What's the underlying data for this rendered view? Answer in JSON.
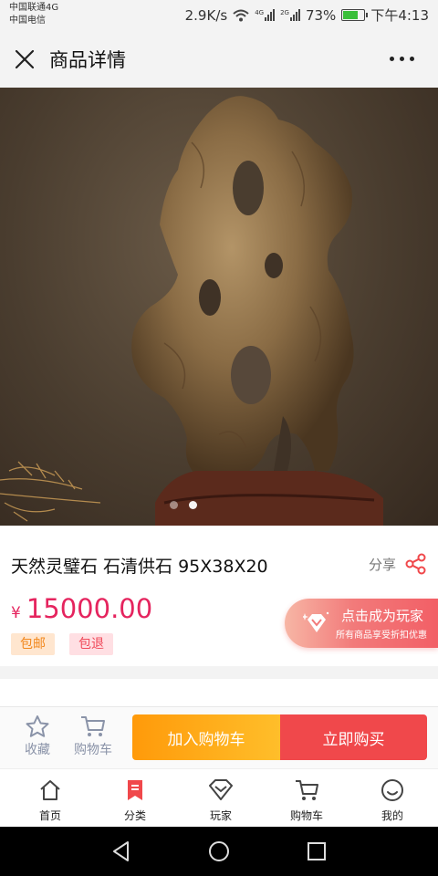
{
  "status": {
    "carrier1": "中国联通4G",
    "carrier2": "中国电信",
    "speed": "2.9K/s",
    "net1": "4G",
    "net2": "2G",
    "battery": "73%",
    "battery_level": 0.73,
    "time": "下午4:13"
  },
  "nav": {
    "title": "商品详情"
  },
  "gallery": {
    "count": 2,
    "active": 2
  },
  "product": {
    "title": "天然灵璧石 石清供石 95X38X20",
    "share": "分享",
    "currency": "¥",
    "price": "15000.00",
    "tags": [
      "包邮",
      "包退"
    ]
  },
  "promo": {
    "main": "点击成为玩家",
    "sub": "所有商品享受折扣优惠"
  },
  "actions": {
    "favorite": "收藏",
    "cart": "购物车",
    "add_cart": "加入购物车",
    "buy_now": "立即购买"
  },
  "tabs": [
    {
      "label": "首页"
    },
    {
      "label": "分类"
    },
    {
      "label": "玩家"
    },
    {
      "label": "购物车"
    },
    {
      "label": "我的"
    }
  ],
  "colors": {
    "price": "#e5245e",
    "accent": "#f0484b",
    "orange": "#ff9a0a"
  }
}
